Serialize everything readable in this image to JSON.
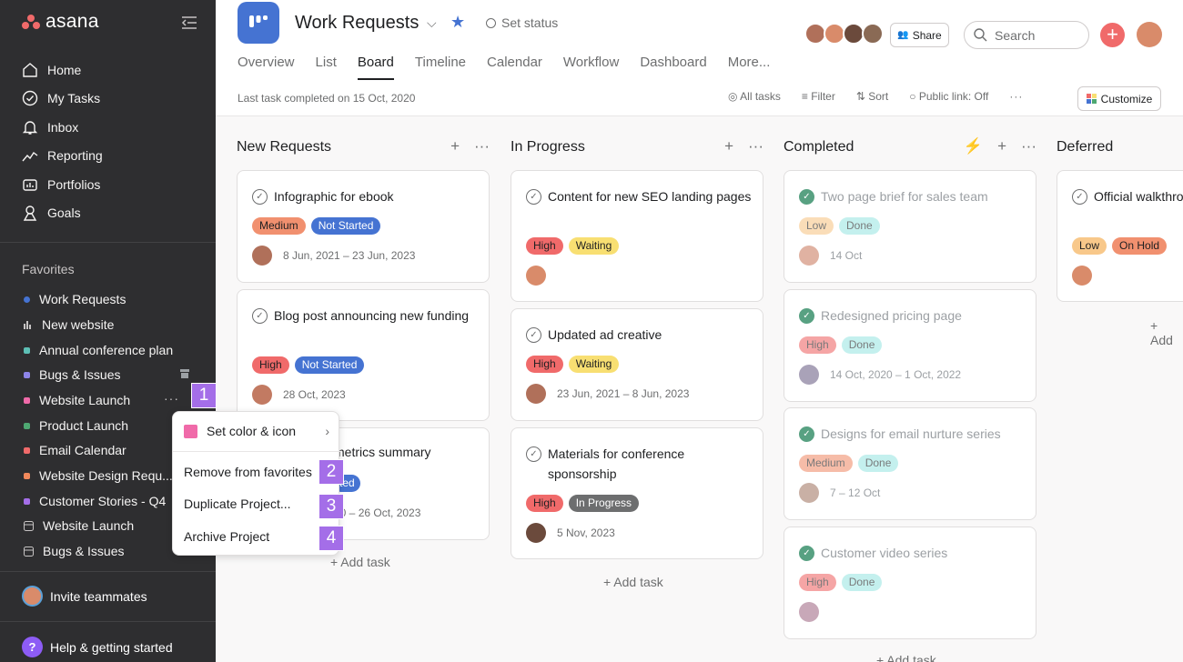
{
  "sidebar": {
    "brand": "asana",
    "nav": [
      {
        "label": "Home",
        "icon": "home-icon"
      },
      {
        "label": "My Tasks",
        "icon": "check-circle-icon"
      },
      {
        "label": "Inbox",
        "icon": "bell-icon"
      },
      {
        "label": "Reporting",
        "icon": "chart-line-icon"
      },
      {
        "label": "Portfolios",
        "icon": "portfolio-icon"
      },
      {
        "label": "Goals",
        "icon": "goals-icon"
      }
    ],
    "favorites_title": "Favorites",
    "favorites": [
      {
        "label": "Work Requests",
        "color": "#4573d2",
        "icon": "dot"
      },
      {
        "label": "New website",
        "color": "#c7c4c4",
        "icon": "bar-chart-icon"
      },
      {
        "label": "Annual conference plan",
        "color": "#5dbfb5",
        "icon": "dot"
      },
      {
        "label": "Bugs & Issues",
        "color": "#8d84e8",
        "icon": "dot"
      },
      {
        "label": "Website Launch",
        "color": "#f06aa9",
        "icon": "dot"
      },
      {
        "label": "Product Launch",
        "color": "#4ea872",
        "icon": "dot"
      },
      {
        "label": "Email Calendar",
        "color": "#f06a6a",
        "icon": "dot"
      },
      {
        "label": "Website Design Requ...",
        "color": "#f1895b",
        "icon": "dot"
      },
      {
        "label": "Customer Stories - Q4",
        "color": "#a46ee8",
        "icon": "dot"
      },
      {
        "label": "Website Launch",
        "color": "#c7c4c4",
        "icon": "board-icon"
      },
      {
        "label": "Bugs & Issues",
        "color": "#c7c4c4",
        "icon": "board-icon"
      }
    ],
    "invite": "Invite teammates",
    "help": "Help & getting started"
  },
  "header": {
    "title": "Work Requests",
    "set_status": "Set status",
    "tabs": [
      "Overview",
      "List",
      "Board",
      "Timeline",
      "Calendar",
      "Workflow",
      "Dashboard",
      "More..."
    ],
    "active_tab": "Board",
    "share": "Share",
    "search_placeholder": "Search",
    "last_completed": "Last task completed on 15 Oct, 2020",
    "toolbar": {
      "all_tasks": "All tasks",
      "filter": "Filter",
      "sort": "Sort",
      "public_link": "Public link: Off",
      "customize": "Customize"
    }
  },
  "columns": [
    {
      "title": "New Requests",
      "cards": [
        {
          "title": "Infographic for ebook",
          "tags": [
            {
              "label": "Medium",
              "bg": "#f1906f"
            },
            {
              "label": "Not Started",
              "bg": "#4573d2",
              "fg": "#fff"
            }
          ],
          "date": "8 Jun, 2021 – 23 Jun, 2023"
        },
        {
          "title": "Blog post announcing new funding",
          "tags": [
            {
              "label": "High",
              "bg": "#f06a6a"
            },
            {
              "label": "Not Started",
              "bg": "#4573d2",
              "fg": "#fff"
            }
          ],
          "date": "28 Oct, 2023"
        },
        {
          "title": "metrics summary",
          "tags": [
            {
              "label": "ted",
              "bg": "#4573d2",
              "fg": "#fff"
            }
          ],
          "date": "20 – 26 Oct, 2023"
        }
      ],
      "add_task": "+ Add task"
    },
    {
      "title": "In Progress",
      "cards": [
        {
          "title": "Content for new SEO landing pages",
          "tags": [
            {
              "label": "High",
              "bg": "#f06a6a"
            },
            {
              "label": "Waiting",
              "bg": "#f8df72"
            }
          ],
          "date": ""
        },
        {
          "title": "Updated ad creative",
          "tags": [
            {
              "label": "High",
              "bg": "#f06a6a"
            },
            {
              "label": "Waiting",
              "bg": "#f8df72"
            }
          ],
          "date": "23 Jun, 2021 – 8 Jun, 2023"
        },
        {
          "title": "Materials for conference sponsorship",
          "tags": [
            {
              "label": "High",
              "bg": "#f06a6a"
            },
            {
              "label": "In Progress",
              "bg": "#6d6e6f",
              "fg": "#fff"
            }
          ],
          "date": "5 Nov, 2023"
        }
      ],
      "add_task": "+ Add task"
    },
    {
      "title": "Completed",
      "cards": [
        {
          "title": "Two page brief for sales team",
          "tags": [
            {
              "label": "Low",
              "bg": "#f8c88a"
            },
            {
              "label": "Done",
              "bg": "#9ee7e3"
            }
          ],
          "date": "14 Oct"
        },
        {
          "title": "Redesigned pricing page",
          "tags": [
            {
              "label": "High",
              "bg": "#f06a6a"
            },
            {
              "label": "Done",
              "bg": "#9ee7e3"
            }
          ],
          "date": "14 Oct, 2020 – 1 Oct, 2022"
        },
        {
          "title": "Designs for email nurture series",
          "tags": [
            {
              "label": "Medium",
              "bg": "#f1906f"
            },
            {
              "label": "Done",
              "bg": "#9ee7e3"
            }
          ],
          "date": "7 – 12 Oct"
        },
        {
          "title": "Customer video series",
          "tags": [
            {
              "label": "High",
              "bg": "#f06a6a"
            },
            {
              "label": "Done",
              "bg": "#9ee7e3"
            }
          ],
          "date": ""
        }
      ],
      "add_task": "+ Add task"
    },
    {
      "title": "Deferred",
      "cards": [
        {
          "title": "Official walkthrough candidates",
          "tags": [
            {
              "label": "Low",
              "bg": "#f8c88a"
            },
            {
              "label": "On Hold",
              "bg": "#f1906f"
            }
          ],
          "date": ""
        }
      ],
      "add_task": "+ Add"
    }
  ],
  "context_menu": {
    "items": [
      "Set color & icon",
      "Remove from favorites",
      "Duplicate Project...",
      "Archive Project"
    ]
  },
  "markers": [
    "1",
    "2",
    "3",
    "4"
  ]
}
